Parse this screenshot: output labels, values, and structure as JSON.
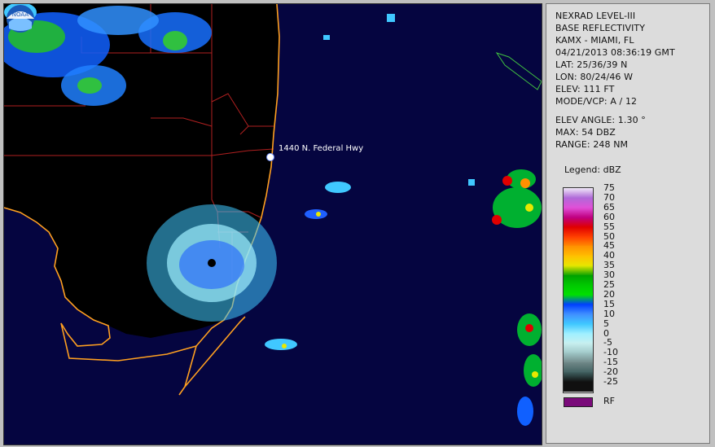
{
  "info_lines": {
    "l1": "NEXRAD LEVEL-III",
    "l2": "BASE REFLECTIVITY",
    "l3": "KAMX - MIAMI, FL",
    "l4": "04/21/2013 08:36:19 GMT",
    "l5": "LAT: 25/36/39 N",
    "l6": "LON: 80/24/46 W",
    "l7": "ELEV: 111 FT",
    "l8": "MODE/VCP: A / 12",
    "l9": "ELEV ANGLE: 1.30 °",
    "l10": "MAX: 54 DBZ",
    "l11": "RANGE: 248 NM"
  },
  "legend": {
    "title": "Legend: dBZ",
    "labels": [
      "75",
      "70",
      "65",
      "60",
      "55",
      "50",
      "45",
      "40",
      "35",
      "30",
      "25",
      "20",
      "15",
      "10",
      "5",
      "0",
      "-5",
      "-10",
      "-15",
      "-20",
      "-25"
    ],
    "colors": [
      "#f0e8f8",
      "#b06ad8",
      "#e050d8",
      "#c00080",
      "#e00000",
      "#ff4000",
      "#ff9000",
      "#ffc000",
      "#e8e800",
      "#00a000",
      "#00c800",
      "#00e000",
      "#0040ff",
      "#4090ff",
      "#40c8ff",
      "#a0f0ff",
      "#c8f0f0",
      "#a0c8c8",
      "#708888",
      "#406060",
      "#101010"
    ],
    "rf_label": "RF",
    "rf_color": "#7a0a7a"
  },
  "map": {
    "marker_label": "1440 N. Federal Hwy",
    "background": "#050540",
    "land_color": "#000000",
    "county_line_color": "#b02020",
    "state_line_color": "#ffa020"
  },
  "logo_text": "NOAA"
}
